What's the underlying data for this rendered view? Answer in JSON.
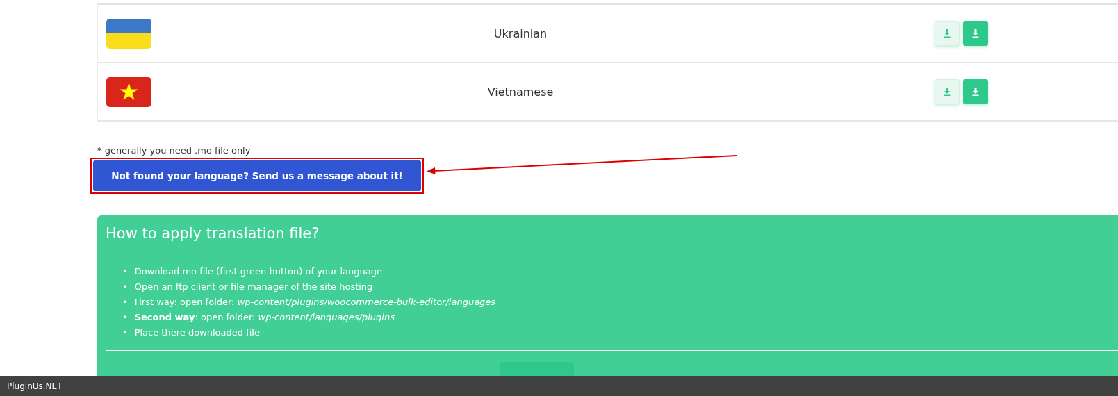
{
  "languages": [
    {
      "name": "Ukrainian",
      "flag": {
        "kind": "bands"
      },
      "buttons": [
        {
          "kind": "light"
        },
        {
          "kind": "solid"
        }
      ]
    },
    {
      "name": "Vietnamese",
      "flag": {
        "kind": "star"
      },
      "buttons": [
        {
          "kind": "light"
        },
        {
          "kind": "solid"
        }
      ]
    }
  ],
  "note": "* generally you need .mo file only",
  "request_button": "Not found your language? Send us a message about it!",
  "help": {
    "title": "How to apply translation file?",
    "steps": [
      "Download mo file (first green button) of your language",
      "Open an ftp client or file manager of the site hosting",
      "First way: open folder: *wp-content/plugins/woocommerce-bulk-editor/languages*",
      "**Second way**: open folder: *wp-content/languages/plugins*",
      "Place there downloaded file"
    ],
    "marker": "•"
  },
  "bottom_bar": "PluginUs.NET"
}
